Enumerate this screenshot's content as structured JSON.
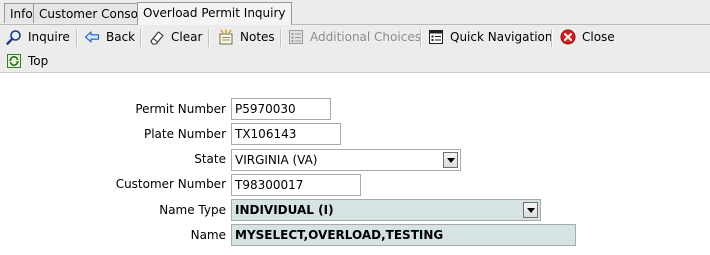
{
  "tabs": [
    {
      "label": "Info"
    },
    {
      "label": "Customer Console"
    },
    {
      "label": "Overload Permit Inquiry"
    }
  ],
  "toolbar": {
    "inquire": "Inquire",
    "back": "Back",
    "clear": "Clear",
    "notes": "Notes",
    "additional_choices": "Additional Choices",
    "quick_navigation": "Quick Navigation",
    "close": "Close",
    "top": "Top"
  },
  "form": {
    "permit_number": {
      "label": "Permit Number",
      "value": "P5970030"
    },
    "plate_number": {
      "label": "Plate Number",
      "value": "TX106143"
    },
    "state": {
      "label": "State",
      "value": "VIRGINIA (VA)"
    },
    "customer_number": {
      "label": "Customer Number",
      "value": "T98300017"
    },
    "name_type": {
      "label": "Name Type",
      "value": "INDIVIDUAL (I)"
    },
    "name": {
      "label": "Name",
      "value": "MYSELECT,OVERLOAD,TESTING"
    }
  },
  "colors": {
    "readonly_field_bg": "#d5e3e3",
    "close_icon": "#d82020"
  }
}
